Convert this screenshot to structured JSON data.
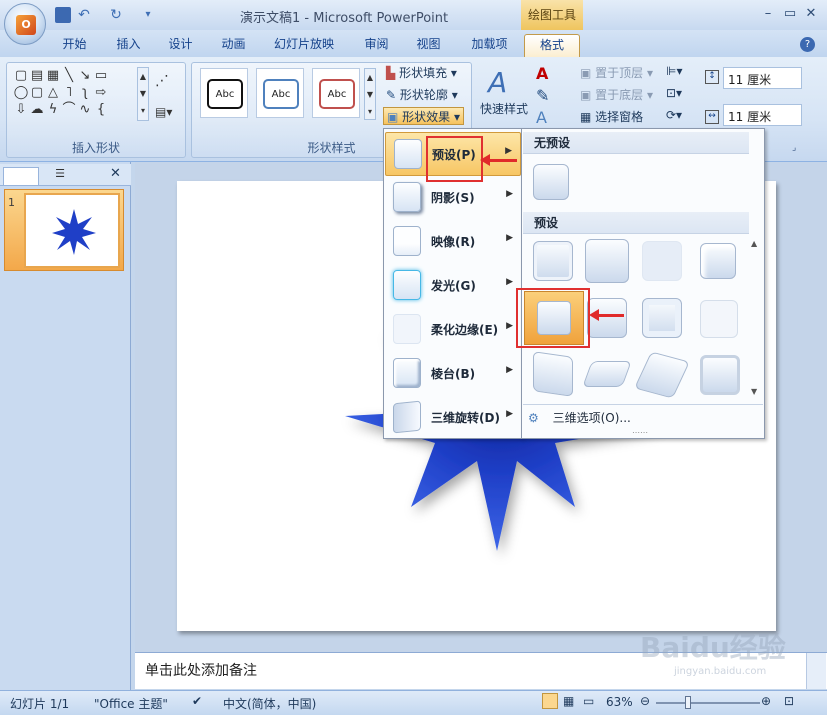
{
  "window": {
    "title": "演示文稿1 - Microsoft PowerPoint",
    "context_tab_group": "绘图工具"
  },
  "tabs": [
    "开始",
    "插入",
    "设计",
    "动画",
    "幻灯片放映",
    "审阅",
    "视图",
    "加载项",
    "格式"
  ],
  "active_tab": "格式",
  "ribbon": {
    "insert_shapes": {
      "label": "插入形状"
    },
    "shape_styles": {
      "label": "形状样式",
      "style_sample_text": "Abc",
      "fill": "形状填充",
      "outline": "形状轮廓",
      "effects": "形状效果"
    },
    "quick_styles": {
      "label": "快速样式"
    },
    "arrange": {
      "bring_front": "置于顶层",
      "send_back": "置于底层",
      "selection_pane": "选择窗格"
    },
    "size": {
      "height": "11 厘米",
      "width": "11 厘米"
    }
  },
  "effects_menu": {
    "items": [
      {
        "label": "预设(P)",
        "highlight": true
      },
      {
        "label": "阴影(S)"
      },
      {
        "label": "映像(R)"
      },
      {
        "label": "发光(G)"
      },
      {
        "label": "柔化边缘(E)"
      },
      {
        "label": "棱台(B)"
      },
      {
        "label": "三维旋转(D)"
      }
    ]
  },
  "preset_submenu": {
    "no_preset_header": "无预设",
    "preset_header": "预设",
    "three_d_options": "三维选项(O)..."
  },
  "slide_panel": {
    "slide_number": "1"
  },
  "notes": {
    "placeholder": "单击此处添加备注"
  },
  "status": {
    "slide": "幻灯片 1/1",
    "theme": "\"Office 主题\"",
    "language": "中文(简体，中国)",
    "zoom": "63%"
  },
  "watermark": {
    "text": "Baidu经验",
    "url": "jingyan.baidu.com"
  },
  "colors": {
    "accent_orange": "#f3a84a",
    "red_annotation": "#e02a2a",
    "star_blue": "#1f3fc7"
  }
}
